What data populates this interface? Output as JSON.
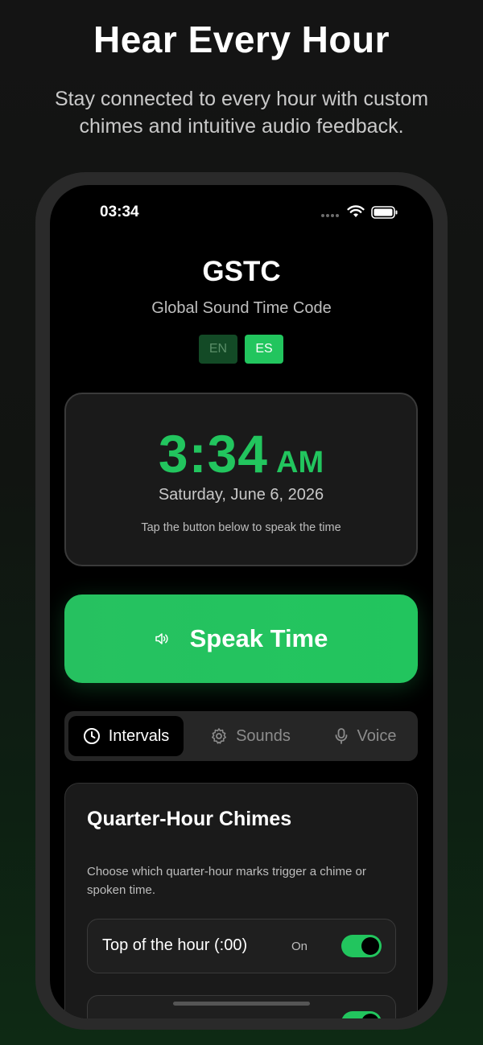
{
  "marketing": {
    "headline": "Hear Every Hour",
    "subheadline": "Stay connected to every hour with custom chimes and intuitive audio feedback."
  },
  "status_bar": {
    "time": "03:34",
    "icons": [
      "cellular-dots-icon",
      "wifi-icon",
      "battery-icon"
    ]
  },
  "app": {
    "title": "GSTC",
    "subtitle": "Global Sound Time Code",
    "languages": [
      {
        "code": "EN",
        "selected": false
      },
      {
        "code": "ES",
        "selected": true
      }
    ]
  },
  "clock": {
    "time": "3:34",
    "ampm": "AM",
    "date": "Saturday, June 6, 2026",
    "hint": "Tap the button below to speak the time"
  },
  "speak_button": {
    "label": "Speak Time",
    "icon": "speaker-icon"
  },
  "tabs": [
    {
      "label": "Intervals",
      "icon": "clock-icon",
      "active": true
    },
    {
      "label": "Sounds",
      "icon": "gear-icon",
      "active": false
    },
    {
      "label": "Voice",
      "icon": "microphone-icon",
      "active": false
    }
  ],
  "quarter_hour": {
    "title": "Quarter-Hour Chimes",
    "description": "Choose which quarter-hour marks trigger a chime or spoken time.",
    "rows": [
      {
        "label": "Top of the hour (:00)",
        "state": "On",
        "enabled": true
      },
      {
        "label": "",
        "state": "",
        "enabled": true
      }
    ]
  },
  "colors": {
    "accent": "#22c55e",
    "background": "#000000",
    "card": "#1a1a1a",
    "muted_text": "#bdbdbd"
  }
}
